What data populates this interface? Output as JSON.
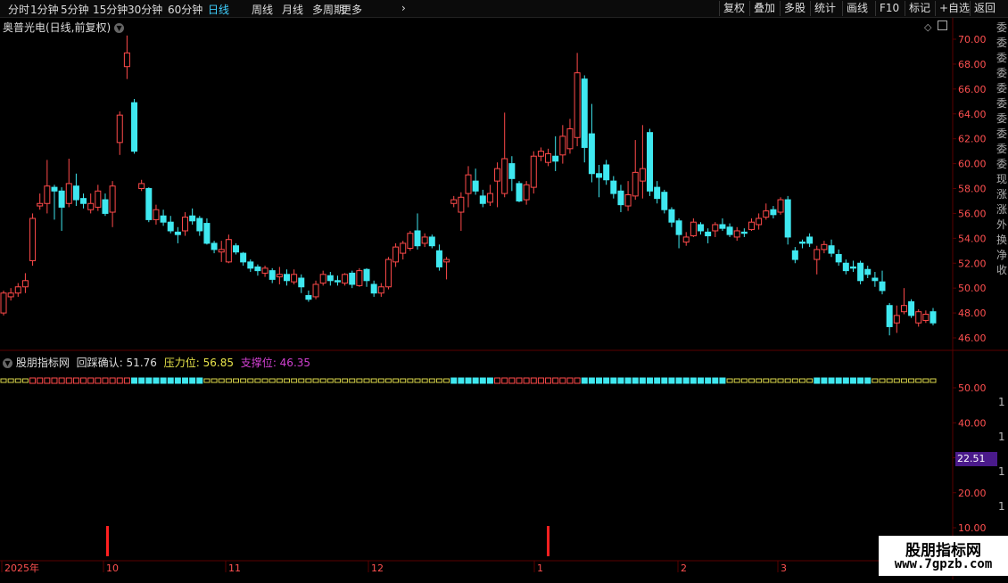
{
  "toolbar": {
    "tabs": [
      "分时",
      "1分钟",
      "5分钟",
      "15分钟",
      "30分钟",
      "60分钟",
      "日线",
      "周线",
      "月线",
      "多周期",
      "更多"
    ],
    "active_tab": "日线",
    "more_arrow": "›",
    "right_buttons": [
      "复权",
      "叠加",
      "多股",
      "统计",
      "画线",
      "F10",
      "标记",
      "+自选",
      "返回"
    ]
  },
  "main_chart": {
    "title": "奥普光电(日线,前复权)",
    "y_ticks": [
      "70.00",
      "68.00",
      "66.00",
      "64.00",
      "62.00",
      "60.00",
      "58.00",
      "56.00",
      "54.00",
      "52.00",
      "50.00",
      "48.00",
      "46.00"
    ],
    "right_side_text": "委 委 委 委 委 委 委 委 委 委 现 涨 涨 外 换 净 收"
  },
  "indicator": {
    "name": "股朋指标网",
    "label1": "回踩确认",
    "value1": "51.76",
    "label2": "压力位",
    "value2": "56.85",
    "label3": "支撑位",
    "value3": "46.35",
    "y_ticks": [
      "50.00",
      "40.00",
      "30.00",
      "20.00",
      "10.00"
    ],
    "current_value_badge": "22.51",
    "right_side_text": "1 1 1 1 1 1"
  },
  "date_axis": [
    "2025年",
    "10",
    "11",
    "12",
    "1",
    "2",
    "3"
  ],
  "watermark": {
    "line1": "股朋指标网",
    "line2": "www.7gpzb.com"
  },
  "colors": {
    "up": "#ff4a4a",
    "down": "#3fe8f0",
    "grid": "#5a0000",
    "yellow": "#d8d44a",
    "pink": "#d040d0",
    "badge": "#4a1a8a"
  },
  "chart_data": {
    "type": "candlestick",
    "ylim": [
      45,
      71
    ],
    "candles": [
      {
        "o": 48,
        "c": 49.6,
        "h": 49.8,
        "l": 47.8
      },
      {
        "o": 49.3,
        "c": 49.6,
        "h": 50,
        "l": 49
      },
      {
        "o": 49.6,
        "c": 50.1,
        "h": 50.4,
        "l": 49.3
      },
      {
        "o": 50.1,
        "c": 50.6,
        "h": 51.2,
        "l": 49.6
      },
      {
        "o": 52.2,
        "c": 55.6,
        "h": 56,
        "l": 51.8
      },
      {
        "o": 56.6,
        "c": 56.8,
        "h": 57.6,
        "l": 56.3
      },
      {
        "o": 56.8,
        "c": 58.2,
        "h": 60.3,
        "l": 56
      },
      {
        "o": 58.1,
        "c": 57.8,
        "h": 58.3,
        "l": 55.5
      },
      {
        "o": 57.8,
        "c": 56.5,
        "h": 58.1,
        "l": 54.6
      },
      {
        "o": 56.8,
        "c": 58.4,
        "h": 60.4,
        "l": 56.5
      },
      {
        "o": 58.2,
        "c": 57.1,
        "h": 59.2,
        "l": 56.6
      },
      {
        "o": 57.2,
        "c": 56.8,
        "h": 57.6,
        "l": 56.4
      },
      {
        "o": 56.3,
        "c": 56.8,
        "h": 57.6,
        "l": 56
      },
      {
        "o": 56.5,
        "c": 57.8,
        "h": 58.3,
        "l": 56.2
      },
      {
        "o": 57.1,
        "c": 56,
        "h": 57.6,
        "l": 55.8
      },
      {
        "o": 56.1,
        "c": 58.2,
        "h": 58.6,
        "l": 54.9
      },
      {
        "o": 61.7,
        "c": 63.9,
        "h": 64.2,
        "l": 60.7
      },
      {
        "o": 67.8,
        "c": 68.9,
        "h": 70.3,
        "l": 66.8
      },
      {
        "o": 64.9,
        "c": 61,
        "h": 65.2,
        "l": 60.8
      },
      {
        "o": 58,
        "c": 58.4,
        "h": 58.7,
        "l": 57.8
      },
      {
        "o": 58,
        "c": 55.5,
        "h": 58.1,
        "l": 55.3
      },
      {
        "o": 55.5,
        "c": 56.3,
        "h": 56.7,
        "l": 55.1
      },
      {
        "o": 55.8,
        "c": 55.3,
        "h": 56.3,
        "l": 55
      },
      {
        "o": 55.3,
        "c": 54.6,
        "h": 55.8,
        "l": 54.4
      },
      {
        "o": 54.5,
        "c": 54.3,
        "h": 54.9,
        "l": 53.6
      },
      {
        "o": 54.6,
        "c": 55.7,
        "h": 56.1,
        "l": 54.2
      },
      {
        "o": 55.8,
        "c": 55.4,
        "h": 56.4,
        "l": 55.1
      },
      {
        "o": 55.6,
        "c": 54.6,
        "h": 55.8,
        "l": 54.2
      },
      {
        "o": 55.2,
        "c": 53.6,
        "h": 55.6,
        "l": 53.5
      },
      {
        "o": 53.6,
        "c": 53.1,
        "h": 53.8,
        "l": 52.8
      },
      {
        "o": 52.9,
        "c": 53.1,
        "h": 53.8,
        "l": 52.1
      },
      {
        "o": 52.1,
        "c": 53.9,
        "h": 54.3,
        "l": 52
      },
      {
        "o": 53.4,
        "c": 52.9,
        "h": 53.6,
        "l": 52.7
      },
      {
        "o": 52.8,
        "c": 52.1,
        "h": 52.9,
        "l": 51.8
      },
      {
        "o": 52.1,
        "c": 51.6,
        "h": 52.3,
        "l": 51.3
      },
      {
        "o": 51.7,
        "c": 51.4,
        "h": 51.9,
        "l": 51
      },
      {
        "o": 51.2,
        "c": 51.6,
        "h": 51.8,
        "l": 50.9
      },
      {
        "o": 51.4,
        "c": 50.7,
        "h": 51.6,
        "l": 50.4
      },
      {
        "o": 50.9,
        "c": 51.1,
        "h": 51.7,
        "l": 50.3
      },
      {
        "o": 51.1,
        "c": 50.6,
        "h": 51.5,
        "l": 50.2
      },
      {
        "o": 50.5,
        "c": 51.1,
        "h": 51.5,
        "l": 50.3
      },
      {
        "o": 50.8,
        "c": 50.1,
        "h": 51.1,
        "l": 49.6
      },
      {
        "o": 49.4,
        "c": 49.1,
        "h": 49.8,
        "l": 48.9
      },
      {
        "o": 49.3,
        "c": 50.3,
        "h": 50.6,
        "l": 49.1
      },
      {
        "o": 50.4,
        "c": 51.1,
        "h": 51.4,
        "l": 50.2
      },
      {
        "o": 51,
        "c": 50.6,
        "h": 51.3,
        "l": 50.2
      },
      {
        "o": 50.6,
        "c": 50.5,
        "h": 51,
        "l": 50.2
      },
      {
        "o": 50.4,
        "c": 51.1,
        "h": 51.2,
        "l": 50.2
      },
      {
        "o": 51.2,
        "c": 50.3,
        "h": 51.4,
        "l": 50
      },
      {
        "o": 50.2,
        "c": 51.4,
        "h": 51.6,
        "l": 50.1
      },
      {
        "o": 51.5,
        "c": 50.6,
        "h": 51.6,
        "l": 50.1
      },
      {
        "o": 50.3,
        "c": 49.6,
        "h": 50.6,
        "l": 49.3
      },
      {
        "o": 49.6,
        "c": 50.1,
        "h": 50.4,
        "l": 49.3
      },
      {
        "o": 50.1,
        "c": 52.3,
        "h": 52.5,
        "l": 49.9
      },
      {
        "o": 52.1,
        "c": 53.3,
        "h": 53.6,
        "l": 51.7
      },
      {
        "o": 52.8,
        "c": 53.6,
        "h": 53.8,
        "l": 52.3
      },
      {
        "o": 53.2,
        "c": 54.4,
        "h": 54.6,
        "l": 53
      },
      {
        "o": 54.6,
        "c": 53.4,
        "h": 56,
        "l": 53.1
      },
      {
        "o": 53.6,
        "c": 54.1,
        "h": 54.4,
        "l": 53.3
      },
      {
        "o": 54.1,
        "c": 53.4,
        "h": 54.3,
        "l": 53.2
      },
      {
        "o": 53,
        "c": 51.7,
        "h": 53.5,
        "l": 51.4
      },
      {
        "o": 52.1,
        "c": 52.3,
        "h": 52.5,
        "l": 50.7
      },
      {
        "o": 56.8,
        "c": 57.1,
        "h": 57.4,
        "l": 56.5
      },
      {
        "o": 56.1,
        "c": 57.3,
        "h": 57.7,
        "l": 54.6
      },
      {
        "o": 57.6,
        "c": 59.1,
        "h": 59.8,
        "l": 56.5
      },
      {
        "o": 58.6,
        "c": 57.8,
        "h": 59.6,
        "l": 57.5
      },
      {
        "o": 57.4,
        "c": 56.8,
        "h": 57.9,
        "l": 56.5
      },
      {
        "o": 56.9,
        "c": 57.6,
        "h": 58.3,
        "l": 56.6
      },
      {
        "o": 58.6,
        "c": 59.6,
        "h": 60.1,
        "l": 56.5
      },
      {
        "o": 57.6,
        "c": 60.4,
        "h": 64.1,
        "l": 57.3
      },
      {
        "o": 60,
        "c": 58.8,
        "h": 60.6,
        "l": 57.8
      },
      {
        "o": 58.4,
        "c": 57,
        "h": 58.6,
        "l": 56.9
      },
      {
        "o": 57.1,
        "c": 58.3,
        "h": 58.6,
        "l": 56.7
      },
      {
        "o": 58.1,
        "c": 60.6,
        "h": 61,
        "l": 57.6
      },
      {
        "o": 60.6,
        "c": 61,
        "h": 61.3,
        "l": 60.2
      },
      {
        "o": 60.1,
        "c": 60.8,
        "h": 61.2,
        "l": 59.8
      },
      {
        "o": 60.6,
        "c": 60.2,
        "h": 62.2,
        "l": 59.4
      },
      {
        "o": 60.7,
        "c": 62.2,
        "h": 63.1,
        "l": 60
      },
      {
        "o": 61.2,
        "c": 62.8,
        "h": 63.6,
        "l": 60.8
      },
      {
        "o": 62.1,
        "c": 67.3,
        "h": 68.9,
        "l": 61.4
      },
      {
        "o": 66.8,
        "c": 61.3,
        "h": 67.1,
        "l": 60.1
      },
      {
        "o": 62.4,
        "c": 59.2,
        "h": 64.8,
        "l": 58.5
      },
      {
        "o": 59.2,
        "c": 58.9,
        "h": 59.9,
        "l": 57.3
      },
      {
        "o": 59.9,
        "c": 58.7,
        "h": 60.3,
        "l": 58.3
      },
      {
        "o": 58.6,
        "c": 57.6,
        "h": 59,
        "l": 57.2
      },
      {
        "o": 57.8,
        "c": 56.7,
        "h": 58.3,
        "l": 56.1
      },
      {
        "o": 56.6,
        "c": 57.5,
        "h": 58.6,
        "l": 56.2
      },
      {
        "o": 57.4,
        "c": 59.3,
        "h": 61.9,
        "l": 57.1
      },
      {
        "o": 58.6,
        "c": 59.6,
        "h": 63.1,
        "l": 57.2
      },
      {
        "o": 62.5,
        "c": 57.8,
        "h": 62.8,
        "l": 57.4
      },
      {
        "o": 58.1,
        "c": 57.2,
        "h": 58.6,
        "l": 56.8
      },
      {
        "o": 57.7,
        "c": 56.3,
        "h": 57.9,
        "l": 56
      },
      {
        "o": 56.3,
        "c": 55.3,
        "h": 56.5,
        "l": 54.9
      },
      {
        "o": 55.4,
        "c": 54.3,
        "h": 55.6,
        "l": 53.2
      },
      {
        "o": 53.7,
        "c": 54.1,
        "h": 54.5,
        "l": 53.4
      },
      {
        "o": 54.2,
        "c": 55.3,
        "h": 55.6,
        "l": 54.1
      },
      {
        "o": 55.1,
        "c": 54.6,
        "h": 55.3,
        "l": 54.3
      },
      {
        "o": 54.5,
        "c": 54.2,
        "h": 54.8,
        "l": 53.6
      },
      {
        "o": 54.6,
        "c": 55.1,
        "h": 55.3,
        "l": 54.1
      },
      {
        "o": 55.1,
        "c": 54.8,
        "h": 55.6,
        "l": 54.6
      },
      {
        "o": 54.9,
        "c": 54.3,
        "h": 55.2,
        "l": 54.1
      },
      {
        "o": 54.1,
        "c": 54.6,
        "h": 54.9,
        "l": 53.8
      },
      {
        "o": 54.5,
        "c": 54.4,
        "h": 54.8,
        "l": 54.1
      },
      {
        "o": 54.7,
        "c": 55.3,
        "h": 55.6,
        "l": 54.6
      },
      {
        "o": 55.1,
        "c": 55.6,
        "h": 56,
        "l": 54.7
      },
      {
        "o": 55.7,
        "c": 56.2,
        "h": 56.8,
        "l": 55.5
      },
      {
        "o": 56.3,
        "c": 55.9,
        "h": 56.6,
        "l": 55.6
      },
      {
        "o": 56.1,
        "c": 57.1,
        "h": 57.3,
        "l": 55.9
      },
      {
        "o": 57.1,
        "c": 54.1,
        "h": 57.4,
        "l": 53.5
      },
      {
        "o": 53,
        "c": 52.3,
        "h": 53.3,
        "l": 52
      },
      {
        "o": 53.7,
        "c": 53.6,
        "h": 53.9,
        "l": 53.2
      },
      {
        "o": 54.1,
        "c": 53.6,
        "h": 54.4,
        "l": 53.3
      },
      {
        "o": 52.3,
        "c": 53.1,
        "h": 53.4,
        "l": 51.1
      },
      {
        "o": 53.1,
        "c": 53.5,
        "h": 53.8,
        "l": 52.8
      },
      {
        "o": 53.4,
        "c": 52.8,
        "h": 53.9,
        "l": 52.5
      },
      {
        "o": 52.7,
        "c": 52.1,
        "h": 53.1,
        "l": 51.8
      },
      {
        "o": 52,
        "c": 51.4,
        "h": 52.3,
        "l": 51.1
      },
      {
        "o": 51.7,
        "c": 51.6,
        "h": 52.2,
        "l": 51.3
      },
      {
        "o": 52,
        "c": 50.6,
        "h": 52.2,
        "l": 50.3
      },
      {
        "o": 51.5,
        "c": 51.1,
        "h": 51.8,
        "l": 50.8
      },
      {
        "o": 50.8,
        "c": 50.6,
        "h": 51.3,
        "l": 50.1
      },
      {
        "o": 50.5,
        "c": 49.8,
        "h": 51.4,
        "l": 49.5
      },
      {
        "o": 48.6,
        "c": 46.9,
        "h": 48.8,
        "l": 46.2
      },
      {
        "o": 47.2,
        "c": 47.8,
        "h": 48.6,
        "l": 46.4
      },
      {
        "o": 48.1,
        "c": 48.6,
        "h": 50,
        "l": 47.9
      },
      {
        "o": 48.9,
        "c": 47.8,
        "h": 49.1,
        "l": 47.6
      },
      {
        "o": 47.2,
        "c": 48.1,
        "h": 48.3,
        "l": 46.9
      },
      {
        "o": 47.4,
        "c": 47.9,
        "h": 48.2,
        "l": 47.2
      },
      {
        "o": 48.1,
        "c": 47.2,
        "h": 48.4,
        "l": 47
      }
    ]
  }
}
